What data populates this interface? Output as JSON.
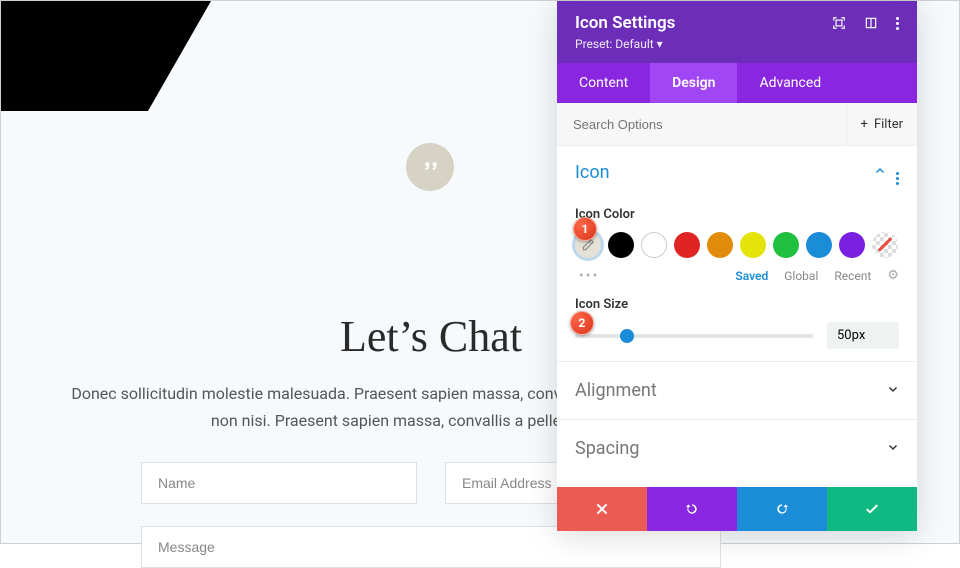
{
  "page": {
    "quote_icon": "quote-icon",
    "chat_title": "Let’s Chat",
    "chat_desc": "Donec sollicitudin molestie malesuada. Praesent sapien massa, convallis a pellentesque nec, egestas non nisi. Praesent sapien massa, convallis a pellentesque nec,",
    "name_placeholder": "Name",
    "email_placeholder": "Email Address",
    "message_placeholder": "Message"
  },
  "panel": {
    "title": "Icon Settings",
    "preset_label": "Preset:",
    "preset_value": "Default",
    "preset_caret": "▾",
    "tabs": {
      "content": "Content",
      "design": "Design",
      "advanced": "Advanced"
    },
    "active_tab": "design",
    "search_placeholder": "Search Options",
    "filter_plus": "+",
    "filter_label": "Filter",
    "sections": {
      "icon": {
        "name": "Icon",
        "icon_color_label": "Icon Color",
        "icon_size_label": "Icon Size",
        "slider_value": "50px",
        "slider_pct": 22,
        "color_tabs": {
          "saved": "Saved",
          "global": "Global",
          "recent": "Recent"
        },
        "swatches": [
          {
            "kind": "picker"
          },
          {
            "hex": "#000000"
          },
          {
            "kind": "white"
          },
          {
            "hex": "#e02424"
          },
          {
            "hex": "#e08b0b"
          },
          {
            "hex": "#e4e40b"
          },
          {
            "hex": "#1fbf3f"
          },
          {
            "hex": "#1a8cd8"
          },
          {
            "hex": "#7a1fe0"
          },
          {
            "kind": "trans"
          }
        ]
      },
      "alignment": {
        "name": "Alignment"
      },
      "spacing": {
        "name": "Spacing"
      }
    }
  },
  "markers": {
    "m1": "1",
    "m2": "2"
  }
}
